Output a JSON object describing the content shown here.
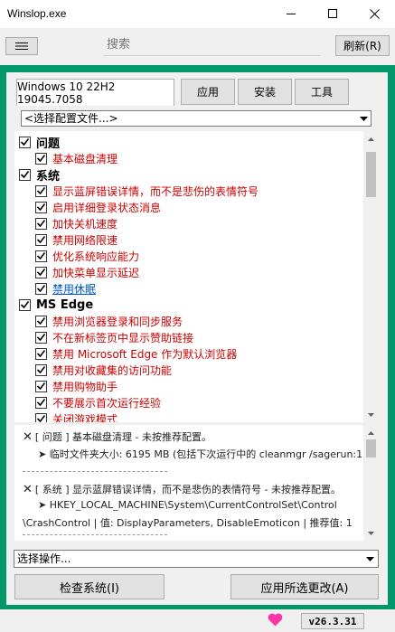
{
  "window": {
    "title": "Winslop.exe"
  },
  "toolbar": {
    "search_placeholder": "搜索",
    "refresh_label": "刷新(R)"
  },
  "tabs": [
    {
      "label": "Windows 10 22H2 19045.7058",
      "active": true
    },
    {
      "label": "应用",
      "active": false
    },
    {
      "label": "安装",
      "active": false
    },
    {
      "label": "工具",
      "active": false
    }
  ],
  "config_select": {
    "value": "<选择配置文件...>"
  },
  "tree": {
    "groups": [
      {
        "label": "问题",
        "checked": true,
        "items": [
          {
            "label": "基本磁盘清理",
            "checked": true
          }
        ]
      },
      {
        "label": "系统",
        "checked": true,
        "items": [
          {
            "label": "显示蓝屏错误详情，而不是悲伤的表情符号",
            "checked": true
          },
          {
            "label": "启用详细登录状态消息",
            "checked": true
          },
          {
            "label": "加快关机速度",
            "checked": true
          },
          {
            "label": "禁用网络限速",
            "checked": true
          },
          {
            "label": "优化系统响应能力",
            "checked": true
          },
          {
            "label": "加快菜单显示延迟",
            "checked": true
          },
          {
            "label": "禁用休眠",
            "checked": true,
            "link": true
          }
        ]
      },
      {
        "label": "MS Edge",
        "checked": true,
        "items": [
          {
            "label": "禁用浏览器登录和同步服务",
            "checked": true
          },
          {
            "label": "不在新标签页中显示赞助链接",
            "checked": true
          },
          {
            "label": "禁用 Microsoft Edge 作为默认浏览器",
            "checked": true
          },
          {
            "label": "禁用对收藏集的访问功能",
            "checked": true
          },
          {
            "label": "禁用购物助手",
            "checked": true
          },
          {
            "label": "不要展示首次运行经验",
            "checked": true
          },
          {
            "label": "关闭游戏模式",
            "checked": true
          }
        ]
      }
    ]
  },
  "log": {
    "lines": [
      {
        "text": "[ 问题 ] 基本磁盘清理 - 未按推荐配置。",
        "mark": "✕"
      },
      {
        "text": "➤ 临时文件夹大小:  6195 MB  (包括下次运行中的 cleanmgr /sagerun:1)",
        "mark": ""
      },
      {
        "text": "[ 系统 ] 显示蓝屏错误详情，而不是悲伤的表情符号 - 未按推荐配置。",
        "mark": "✕"
      },
      {
        "text": "➤ HKEY_LOCAL_MACHINE\\System\\CurrentControlSet\\Control",
        "mark": ""
      },
      {
        "text": "\\CrashControl | 值: DisplayParameters, DisableEmoticon | 推荐值: 1",
        "mark": ""
      }
    ]
  },
  "action_select": {
    "value": "选择操作..."
  },
  "buttons": {
    "check_system": "检查系统(I)",
    "apply_changes": "应用所选更改(A)"
  },
  "footer": {
    "version": "v26.3.31"
  },
  "colors": {
    "frame": "#00976a",
    "item_text": "#cc0000",
    "link_text": "#0055cc",
    "heart": "#ff33aa"
  }
}
